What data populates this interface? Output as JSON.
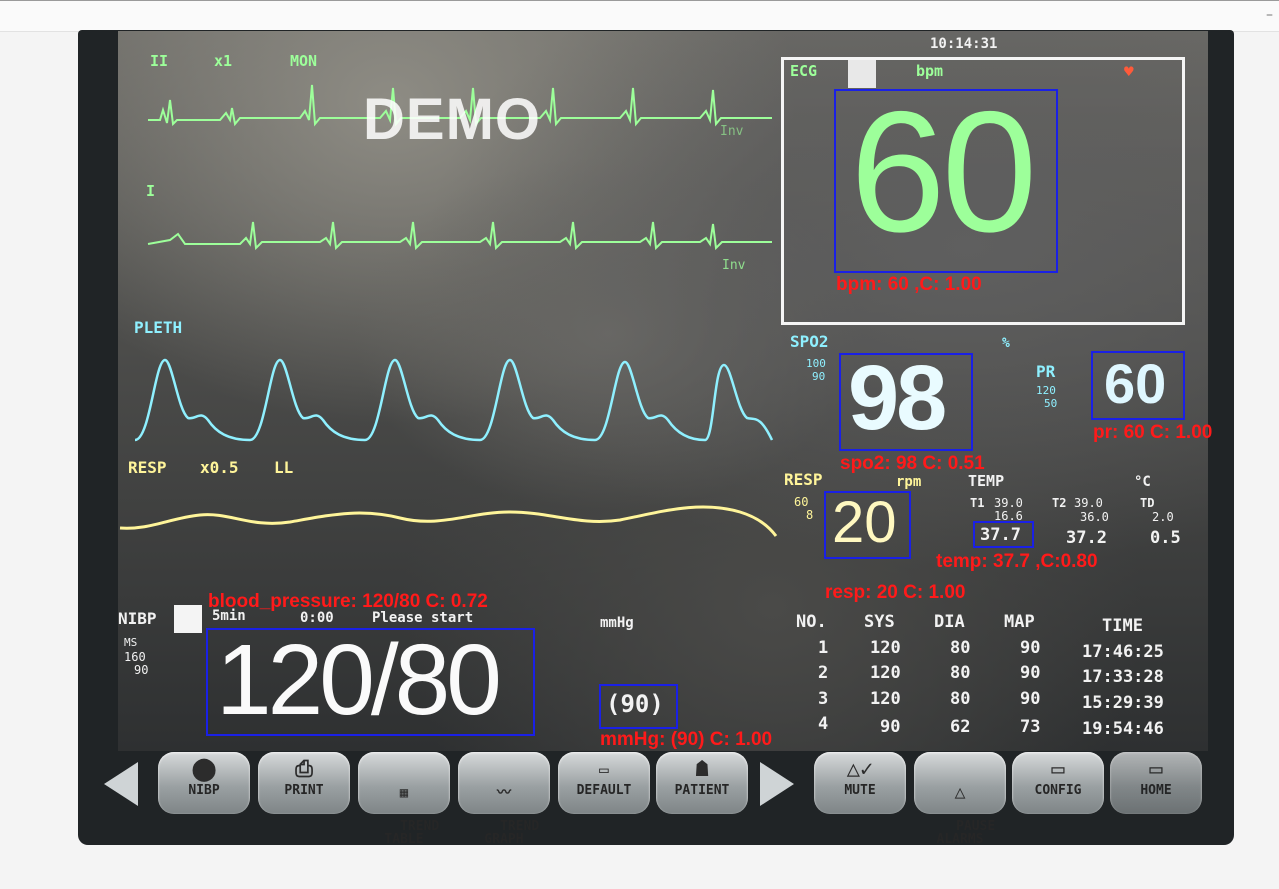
{
  "monitor": {
    "clock": "10:14:31",
    "watermark": "DEMO",
    "ecg_ii": {
      "lead": "II",
      "gain": "x1",
      "mode": "MON",
      "inv": "Inv"
    },
    "ecg_i": {
      "lead": "I",
      "inv": "Inv"
    },
    "pleth_label": "PLETH",
    "resp_wave": {
      "label": "RESP",
      "gain": "x0.5",
      "lead": "LL"
    },
    "ecg_panel": {
      "label": "ECG",
      "unit": "bpm",
      "value": "60"
    },
    "spo2": {
      "label": "SPO2",
      "unit": "%",
      "high": "100",
      "low": "90",
      "value": "98"
    },
    "pr": {
      "label": "PR",
      "high": "120",
      "low": "50",
      "value": "60"
    },
    "resp": {
      "label": "RESP",
      "unit": "rpm",
      "high": "60",
      "low": "8",
      "value": "20"
    },
    "temp": {
      "label": "TEMP",
      "unit": "°C",
      "t1_label": "T1",
      "t1_high": "39.0",
      "t1_low": "16.6",
      "t1_value": "37.7",
      "t2_label": "T2",
      "t2_high": "39.0",
      "t2_low": "36.0",
      "t2_value": "37.2",
      "td_label": "TD",
      "td_high": "2.0",
      "td_value": "0.5"
    },
    "nibp": {
      "label": "NIBP",
      "interval": "5min",
      "timer": "0:00",
      "status": "Please start",
      "unit": "mmHg",
      "mode": "MS",
      "high": "160",
      "low": "90",
      "value": "120/80",
      "mean": "(90)"
    },
    "history": {
      "headers": [
        "NO.",
        "SYS",
        "DIA",
        "MAP",
        "TIME"
      ],
      "rows": [
        [
          "1",
          "120",
          "80",
          "90",
          "17:46:25"
        ],
        [
          "2",
          "120",
          "80",
          "90",
          "17:33:28"
        ],
        [
          "3",
          "120",
          "80",
          "90",
          "15:29:39"
        ],
        [
          "4",
          "90",
          "62",
          "73",
          "19:54:46"
        ]
      ]
    },
    "buttons": [
      {
        "label": "NIBP",
        "icon": "nibp-icon"
      },
      {
        "label": "PRINT",
        "icon": "print-icon"
      },
      {
        "label": "TREND\nTABLE",
        "icon": "trend-table-icon"
      },
      {
        "label": "TREND\nGRAPH",
        "icon": "trend-graph-icon"
      },
      {
        "label": "DEFAULT",
        "icon": "default-icon"
      },
      {
        "label": "PATIENT",
        "icon": "patient-icon"
      },
      {
        "label": "MUTE",
        "icon": "mute-icon"
      },
      {
        "label": "PAUSE\nALARMS",
        "icon": "pause-alarms-icon"
      },
      {
        "label": "CONFIG",
        "icon": "config-icon"
      },
      {
        "label": "HOME",
        "icon": "home-icon"
      }
    ]
  },
  "detections": {
    "bpm": "bpm: 60 ,C: 1.00",
    "spo2": "spo2: 98 C: 0.51",
    "pr": "pr: 60 C: 1.00",
    "temp": "temp: 37.7 ,C:0.80",
    "resp": "resp: 20 C: 1.00",
    "blood_pressure": "blood_pressure: 120/80 C: 0.72",
    "mmhg": "mmHg: (90) C: 1.00"
  },
  "colors": {
    "detection_box": "#1a20e6",
    "detection_label": "#ff1a1a",
    "ecg_wave": "#9dff9a",
    "pleth_wave": "#8ff0ff",
    "resp_wave": "#fff59a"
  }
}
